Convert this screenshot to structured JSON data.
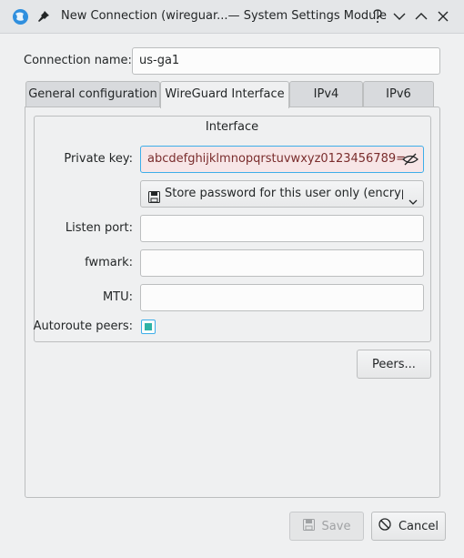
{
  "window": {
    "title": "New Connection (wireguar...— System Settings Module",
    "app_icon": "kde-globe-icon",
    "pin_icon": "pin-icon",
    "help_icon": "help-icon",
    "minimize_icon": "chevron-down-icon",
    "maximize_icon": "chevron-up-icon",
    "close_icon": "close-icon"
  },
  "connection": {
    "name_label": "Connection name:",
    "name_value": "us-ga1"
  },
  "tabs": [
    {
      "label": "General configuration",
      "active": false
    },
    {
      "label": "WireGuard Interface",
      "active": true
    },
    {
      "label": "IPv4",
      "active": false
    },
    {
      "label": "IPv6",
      "active": false
    }
  ],
  "interface": {
    "group_title": "Interface",
    "private_key_label": "Private key:",
    "private_key_value": "abcdefghijklmnopqrstuvwxyz0123456789=",
    "password_store": "Store password for this user only (encrypted)",
    "listen_port_label": "Listen port:",
    "listen_port_value": "",
    "fwmark_label": "fwmark:",
    "fwmark_value": "",
    "mtu_label": "MTU:",
    "mtu_value": "",
    "autoroute_label": "Autoroute peers:",
    "autoroute_checked": true,
    "peers_button": "Peers..."
  },
  "footer": {
    "save_label": "Save",
    "save_enabled": false,
    "cancel_label": "Cancel"
  },
  "colors": {
    "accent": "#3daee9",
    "key_background": "#f7e6e7"
  }
}
